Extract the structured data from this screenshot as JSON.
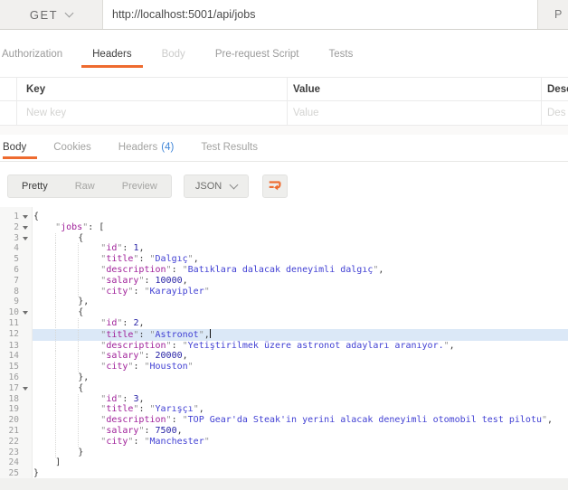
{
  "colors": {
    "accent_orange": "#EE6B2F",
    "headers_count_blue": "#4086D8",
    "json_key": "#A0219A",
    "json_string": "#403FD3",
    "json_number": "#2823A6",
    "active_line_bg": "#DBE8F7"
  },
  "icons": {
    "method_chevron": "chevron-down",
    "language_chevron": "chevron-down",
    "wrap_button": "wrap-lines"
  },
  "request_bar": {
    "method": "GET",
    "url": "http://localhost:5001/api/jobs",
    "params_label": "P"
  },
  "request_tabs": [
    {
      "label": "Authorization",
      "state": "normal"
    },
    {
      "label": "Headers",
      "state": "active"
    },
    {
      "label": "Body",
      "state": "muted"
    },
    {
      "label": "Pre-request Script",
      "state": "normal"
    },
    {
      "label": "Tests",
      "state": "normal"
    }
  ],
  "kv_table": {
    "headers": {
      "key": "Key",
      "value": "Value",
      "desc": "Desc"
    },
    "placeholders": {
      "key": "New key",
      "value": "Value",
      "desc": "Des"
    }
  },
  "response_tabs": [
    {
      "label": "Body",
      "active": true
    },
    {
      "label": "Cookies"
    },
    {
      "label": "Headers",
      "count": "(4)"
    },
    {
      "label": "Test Results"
    }
  ],
  "viewer_toolbar": {
    "modes": [
      {
        "label": "Pretty",
        "active": true
      },
      {
        "label": "Raw"
      },
      {
        "label": "Preview"
      }
    ],
    "language": "JSON"
  },
  "editor": {
    "active_line": 12,
    "fold_lines": [
      1,
      2,
      3,
      10,
      17
    ],
    "lines": [
      "{",
      "    \"jobs\": [",
      "        {",
      "            \"id\": 1,",
      "            \"title\": \"Dalgıç\",",
      "            \"description\": \"Batıklara dalacak deneyimli dalgıç\",",
      "            \"salary\": 10000,",
      "            \"city\": \"Karayipler\"",
      "        },",
      "        {",
      "            \"id\": 2,",
      "            \"title\": \"Astronot\",",
      "            \"description\": \"Yetiştirilmek üzere astronot adayları aranıyor.\",",
      "            \"salary\": 20000,",
      "            \"city\": \"Houston\"",
      "        },",
      "        {",
      "            \"id\": 3,",
      "            \"title\": \"Yarışçı\",",
      "            \"description\": \"TOP Gear'da Steak'in yerini alacak deneyimli otomobil test pilotu\",",
      "            \"salary\": 7500,",
      "            \"city\": \"Manchester\"",
      "        }",
      "    ]",
      "}"
    ]
  }
}
